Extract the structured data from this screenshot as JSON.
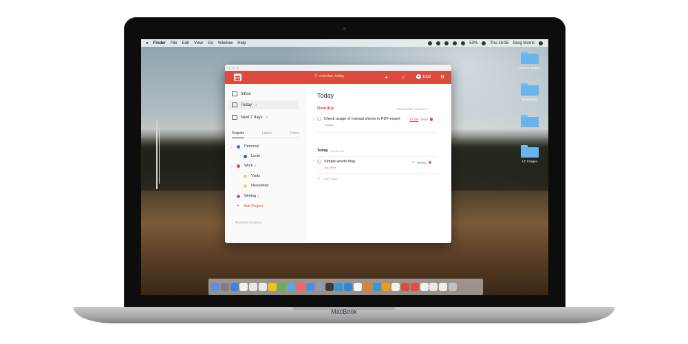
{
  "menubar": {
    "apple": "",
    "items": [
      "Finder",
      "File",
      "Edit",
      "View",
      "Go",
      "Window",
      "Help"
    ],
    "battery": "53%",
    "clock": "Thu 16:35",
    "user": "Greg Morris"
  },
  "device": {
    "brand": "MacBook"
  },
  "app": {
    "search_placeholder": "overdue, today",
    "karma": "1033",
    "nav": [
      {
        "label": "Inbox",
        "count": ""
      },
      {
        "label": "Today",
        "count": "2"
      },
      {
        "label": "Next 7 days",
        "count": "2"
      }
    ],
    "tabs": [
      "Projects",
      "Labels",
      "Filters"
    ],
    "projects": [
      {
        "label": "Personal",
        "count": "",
        "color": "#4073d6"
      },
      {
        "label": "Lucie",
        "count": "",
        "color": "#2c5fc7"
      },
      {
        "label": "Work",
        "count": "1",
        "color": "#db4c3f"
      },
      {
        "label": "Visits",
        "count": "",
        "color": "#f6d84c"
      },
      {
        "label": "Newsletter",
        "count": "",
        "color": "#f6d84c"
      },
      {
        "label": "Writing",
        "count": "1",
        "color": "#c94ecb"
      }
    ],
    "add_project": "Add Project",
    "archived": "Archived projects",
    "main": {
      "title": "Today",
      "overdue_label": "Overdue",
      "reschedule": "Reschedule overdue",
      "tasks_overdue": [
        {
          "title": "Check usage of manual sheets in PDF expert",
          "sub": "Simmy",
          "date": "10 Jan",
          "project": "Work",
          "color": "#db4c3f"
        }
      ],
      "today_label": "Today",
      "today_date": "Thu 12 Jan",
      "tasks_today": [
        {
          "title": "Simple words blog",
          "sub": "Alt_Fiber",
          "project": "Writing",
          "color": "#c94ecb"
        }
      ],
      "add_task": "Add Task"
    }
  },
  "desktop_icons": [
    {
      "label": "Screen Images"
    },
    {
      "label": "Downloads"
    },
    {
      "label": ""
    },
    {
      "label": "LC Images"
    }
  ],
  "dock_colors": [
    "#5c8ee6",
    "#7a7f88",
    "#3b83e0",
    "#f0f0f0",
    "#e8e8e8",
    "#eaeaea",
    "#f1c40f",
    "#6ab04c",
    "#5aa9e6",
    "#ff5f6d",
    "#4a90e2",
    "#8e9aaf",
    "#3a3a3a",
    "#2d98da",
    "#2e86de",
    "#f5f5f5",
    "#e67e22",
    "#3498db",
    "#f39c12",
    "#ecf0f1",
    "#db4c3f",
    "#e74c3c",
    "#f0f0f0",
    "#e8e8e8",
    "#eeeeee",
    "#bdc3c7"
  ]
}
